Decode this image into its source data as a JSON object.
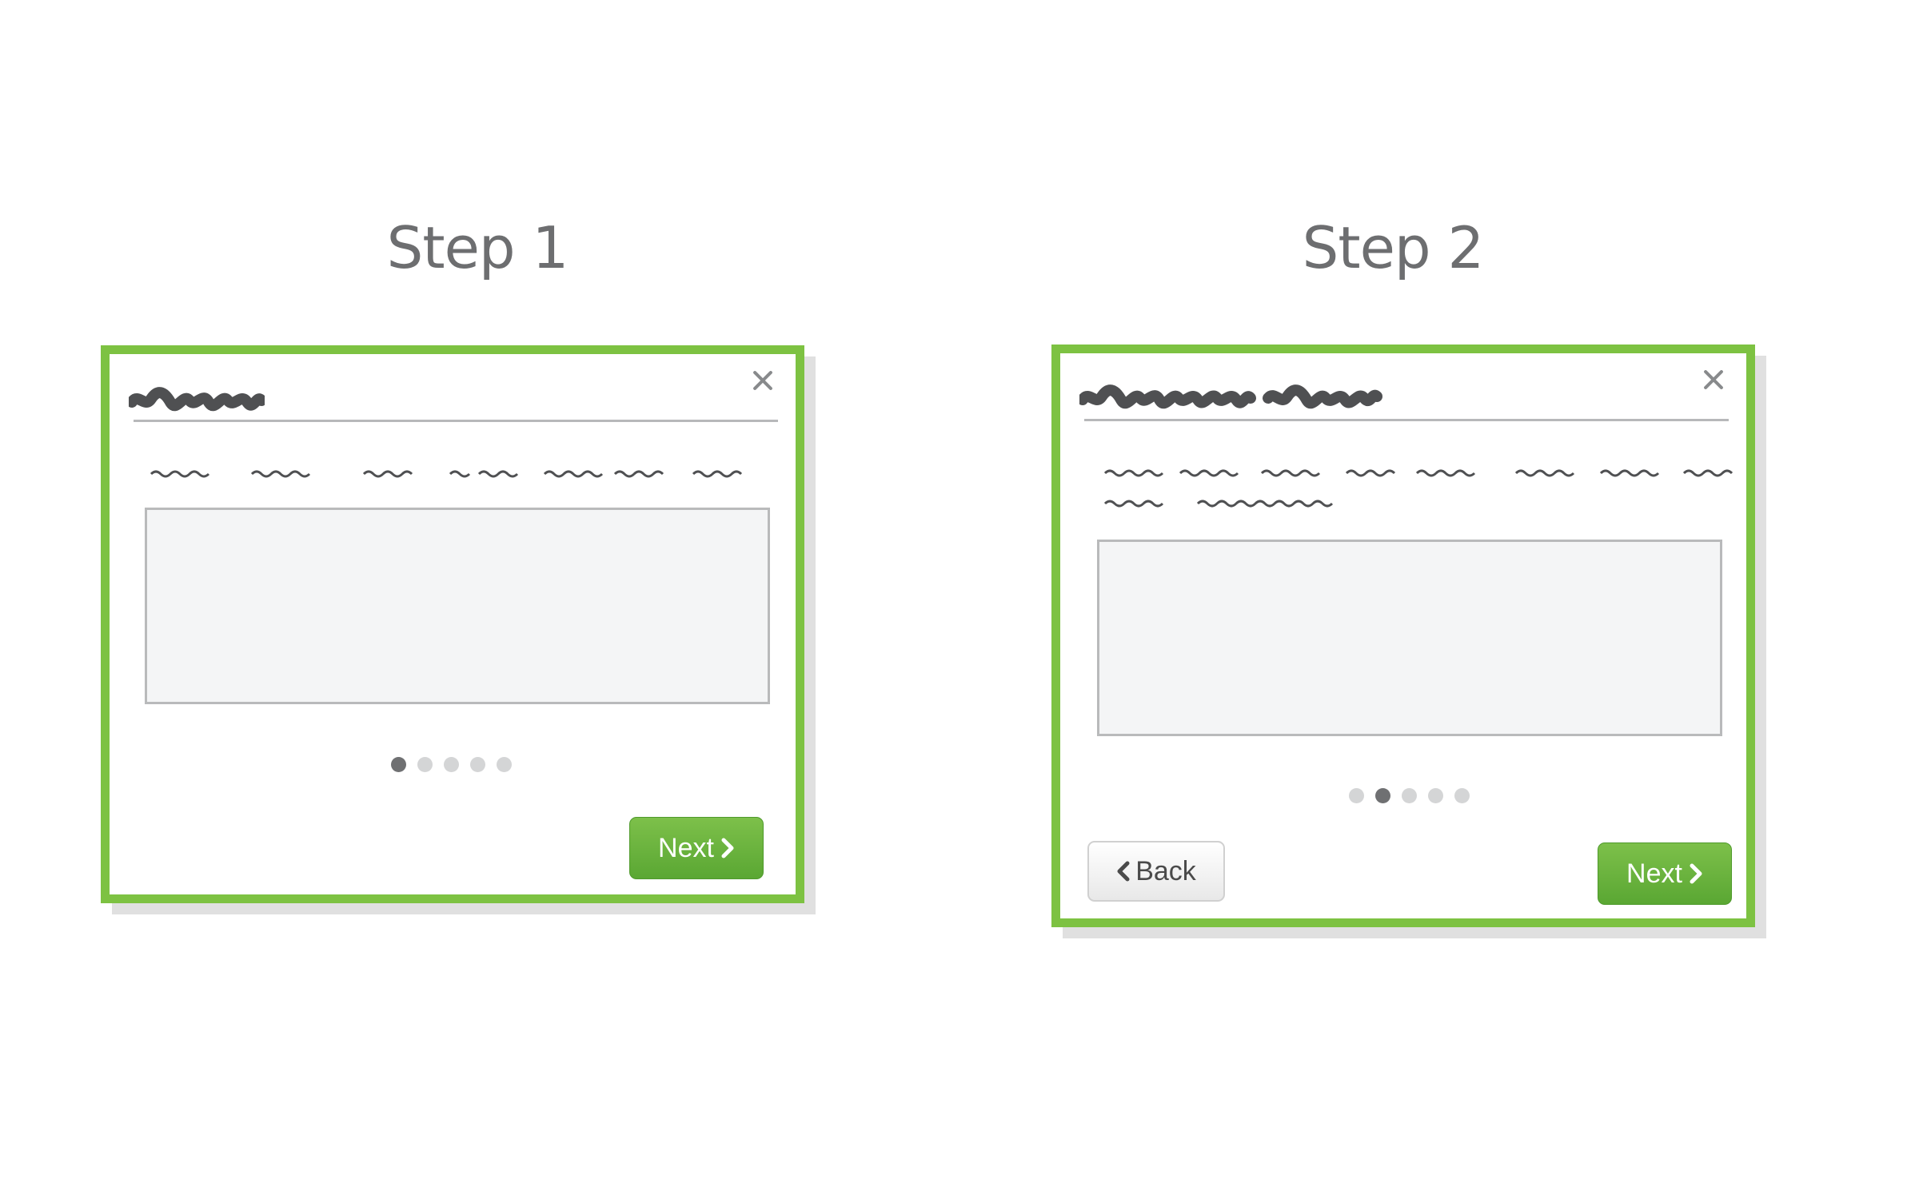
{
  "step1": {
    "title": "Step 1",
    "next_label": "Next",
    "pagination": {
      "total": 5,
      "active": 1
    }
  },
  "step2": {
    "title": "Step 2",
    "back_label": "Back",
    "next_label": "Next",
    "pagination": {
      "total": 5,
      "active": 2
    }
  },
  "colors": {
    "panel_border": "#7dc242",
    "next_button": "#66b23b",
    "title_text": "#6d6e70",
    "active_dot": "#6f7072",
    "inactive_dot": "#d4d5d6"
  },
  "icons": [
    "close-icon",
    "chevron-right-icon",
    "chevron-left-icon"
  ]
}
